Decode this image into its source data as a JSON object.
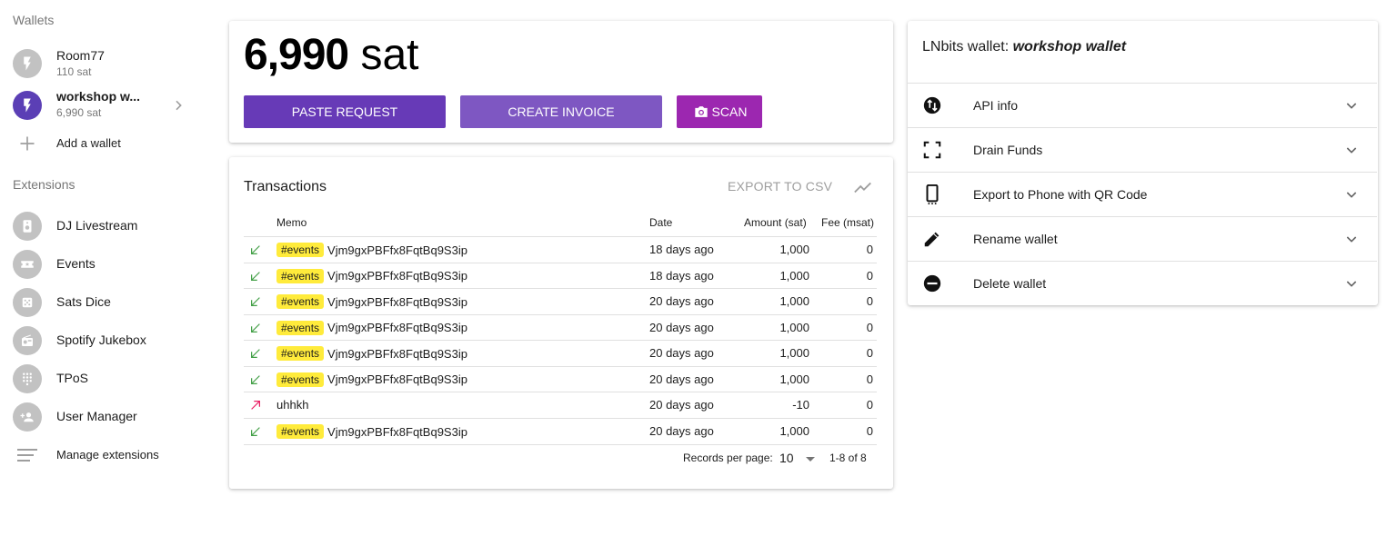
{
  "sidebar": {
    "wallets_title": "Wallets",
    "wallets": [
      {
        "name": "Room77",
        "balance": "110 sat",
        "active": false
      },
      {
        "name": "workshop w...",
        "balance": "6,990 sat",
        "active": true
      }
    ],
    "add_wallet": "Add a wallet",
    "extensions_title": "Extensions",
    "extensions": [
      {
        "label": "DJ Livestream",
        "icon": "speaker-icon"
      },
      {
        "label": "Events",
        "icon": "ticket-icon"
      },
      {
        "label": "Sats Dice",
        "icon": "dice-icon"
      },
      {
        "label": "Spotify Jukebox",
        "icon": "radio-icon"
      },
      {
        "label": "TPoS",
        "icon": "dialpad-icon"
      },
      {
        "label": "User Manager",
        "icon": "person-add-icon"
      }
    ],
    "manage_extensions": "Manage extensions"
  },
  "balance": {
    "amount": "6,990",
    "unit": "sat"
  },
  "actions": {
    "paste_request": "PASTE REQUEST",
    "create_invoice": "CREATE INVOICE",
    "scan": "SCAN"
  },
  "transactions": {
    "title": "Transactions",
    "export_csv": "EXPORT TO CSV",
    "columns": {
      "memo": "Memo",
      "date": "Date",
      "amount": "Amount (sat)",
      "fee": "Fee (msat)"
    },
    "rows": [
      {
        "direction": "incoming",
        "tag": "#events",
        "memo": "Vjm9gxPBFfx8FqtBq9S3ip",
        "date": "18 days ago",
        "amount": "1,000",
        "fee": "0"
      },
      {
        "direction": "incoming",
        "tag": "#events",
        "memo": "Vjm9gxPBFfx8FqtBq9S3ip",
        "date": "18 days ago",
        "amount": "1,000",
        "fee": "0"
      },
      {
        "direction": "incoming",
        "tag": "#events",
        "memo": "Vjm9gxPBFfx8FqtBq9S3ip",
        "date": "20 days ago",
        "amount": "1,000",
        "fee": "0"
      },
      {
        "direction": "incoming",
        "tag": "#events",
        "memo": "Vjm9gxPBFfx8FqtBq9S3ip",
        "date": "20 days ago",
        "amount": "1,000",
        "fee": "0"
      },
      {
        "direction": "incoming",
        "tag": "#events",
        "memo": "Vjm9gxPBFfx8FqtBq9S3ip",
        "date": "20 days ago",
        "amount": "1,000",
        "fee": "0"
      },
      {
        "direction": "incoming",
        "tag": "#events",
        "memo": "Vjm9gxPBFfx8FqtBq9S3ip",
        "date": "20 days ago",
        "amount": "1,000",
        "fee": "0"
      },
      {
        "direction": "outgoing",
        "tag": "",
        "memo": "uhhkh",
        "date": "20 days ago",
        "amount": "-10",
        "fee": "0"
      },
      {
        "direction": "incoming",
        "tag": "#events",
        "memo": "Vjm9gxPBFfx8FqtBq9S3ip",
        "date": "20 days ago",
        "amount": "1,000",
        "fee": "0"
      }
    ],
    "pagination": {
      "records_label": "Records per page:",
      "per_page": "10",
      "range": "1-8 of 8"
    }
  },
  "wallet_panel": {
    "title_prefix": "LNbits wallet: ",
    "wallet_name": "workshop wallet",
    "items": [
      {
        "label": "API info",
        "icon": "api-swap-icon"
      },
      {
        "label": "Drain Funds",
        "icon": "scan-frame-icon"
      },
      {
        "label": "Export to Phone with QR Code",
        "icon": "phone-icon"
      },
      {
        "label": "Rename wallet",
        "icon": "pencil-icon"
      },
      {
        "label": "Delete wallet",
        "icon": "remove-circle-icon"
      }
    ]
  },
  "colors": {
    "primary": "#673ab7",
    "secondary": "#7e57c2",
    "accent": "#9c27b0",
    "tag": "#ffeb3b",
    "incoming": "#43a047",
    "outgoing": "#e91e63"
  }
}
